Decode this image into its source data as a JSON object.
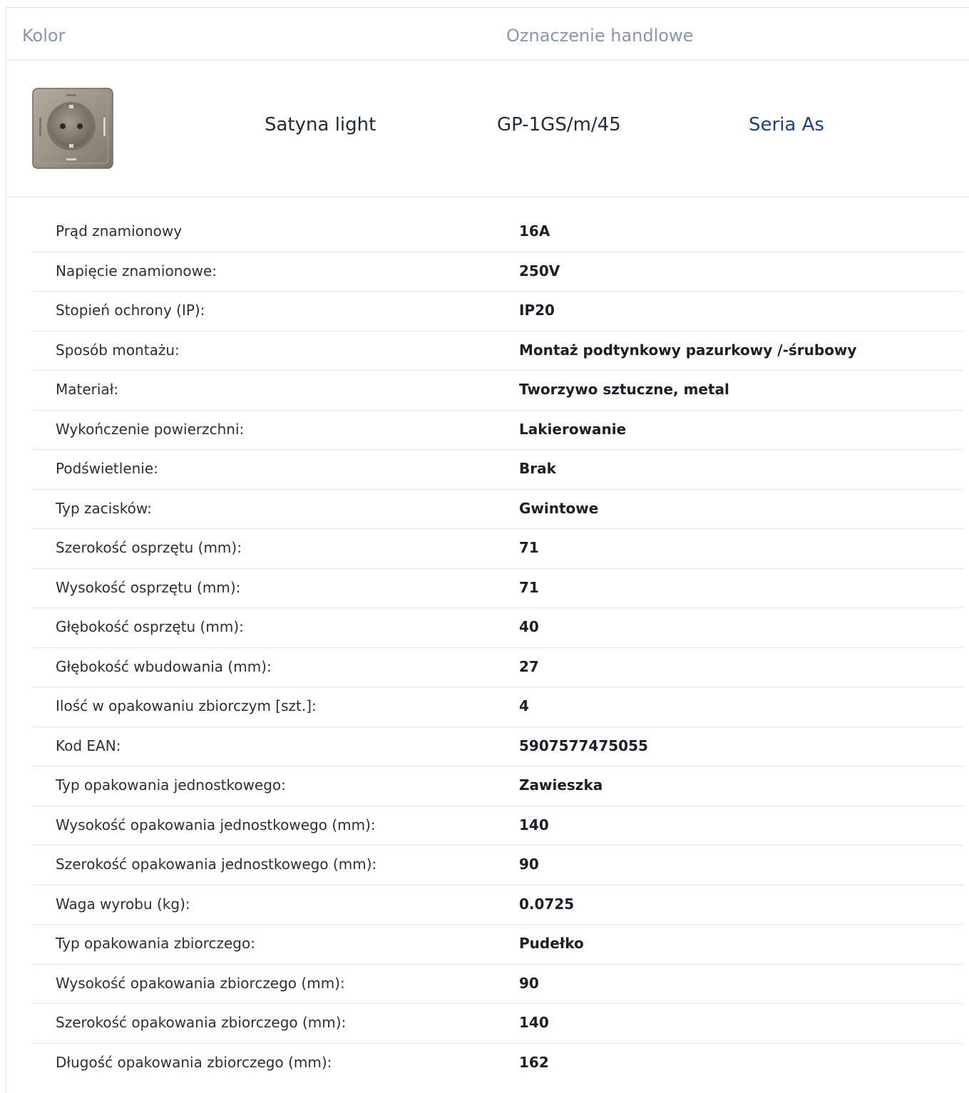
{
  "header": {
    "col_color": "Kolor",
    "col_trade": "Oznaczenie handlowe"
  },
  "product": {
    "image_icon": "socket-icon",
    "color_name": "Satyna light",
    "code": "GP-1GS/m/45",
    "series_link": "Seria As"
  },
  "colors": {
    "header_text": "#8896b3",
    "link": "#1d3f8a",
    "border": "#e2e5ea"
  },
  "specs": [
    {
      "label": "Prąd znamionowy",
      "value": "16A"
    },
    {
      "label": "Napięcie znamionowe:",
      "value": "250V"
    },
    {
      "label": "Stopień ochrony (IP):",
      "value": "IP20"
    },
    {
      "label": "Sposób montażu:",
      "value": "Montaż podtynkowy pazurkowy /-śrubowy"
    },
    {
      "label": "Materiał:",
      "value": "Tworzywo sztuczne, metal"
    },
    {
      "label": "Wykończenie powierzchni:",
      "value": "Lakierowanie"
    },
    {
      "label": "Podświetlenie:",
      "value": "Brak"
    },
    {
      "label": "Typ zacisków:",
      "value": "Gwintowe"
    },
    {
      "label": "Szerokość osprzętu (mm):",
      "value": "71"
    },
    {
      "label": "Wysokość osprzętu (mm):",
      "value": "71"
    },
    {
      "label": "Głębokość osprzętu (mm):",
      "value": "40"
    },
    {
      "label": "Głębokość wbudowania (mm):",
      "value": "27"
    },
    {
      "label": "Ilość w opakowaniu zbiorczym [szt.]:",
      "value": "4"
    },
    {
      "label": "Kod EAN:",
      "value": "5907577475055"
    },
    {
      "label": "Typ opakowania jednostkowego:",
      "value": "Zawieszka"
    },
    {
      "label": "Wysokość opakowania jednostkowego (mm):",
      "value": "140"
    },
    {
      "label": "Szerokość opakowania jednostkowego (mm):",
      "value": "90"
    },
    {
      "label": "Waga wyrobu (kg):",
      "value": "0.0725"
    },
    {
      "label": "Typ opakowania zbiorczego:",
      "value": "Pudełko"
    },
    {
      "label": "Wysokość opakowania zbiorczego (mm):",
      "value": "90"
    },
    {
      "label": "Szerokość opakowania zbiorczego (mm):",
      "value": "140"
    },
    {
      "label": "Długość opakowania zbiorczego (mm):",
      "value": "162"
    }
  ]
}
